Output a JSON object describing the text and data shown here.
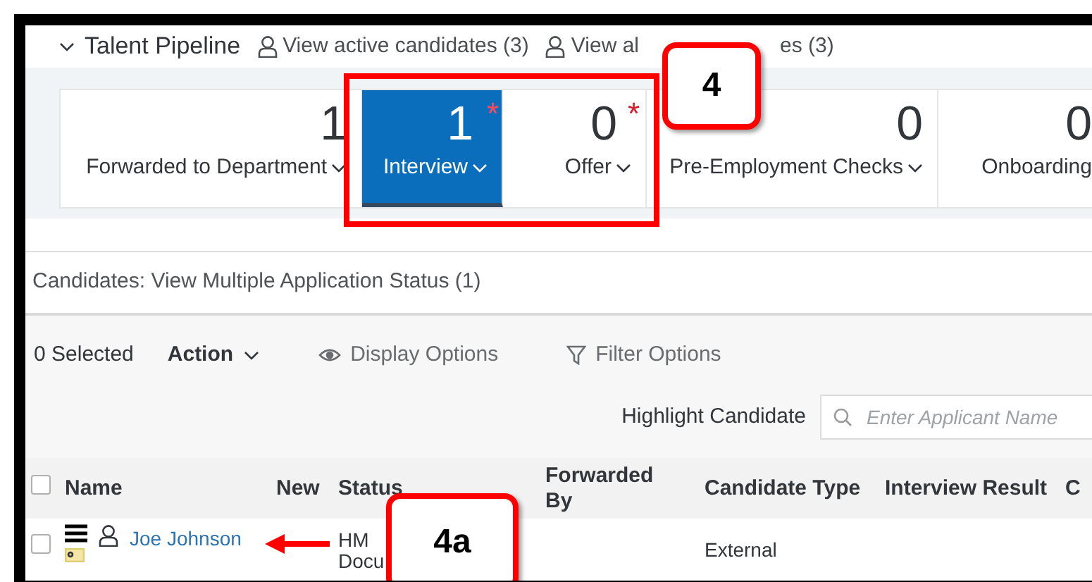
{
  "pipeline": {
    "title": "Talent Pipeline",
    "expanded": true,
    "links": [
      {
        "parts": [
          "View active candidates (3)"
        ]
      },
      {
        "parts": [
          "View al",
          "es (3)"
        ]
      }
    ]
  },
  "stages": [
    {
      "count": "1",
      "label": "Forwarded to Department",
      "selected": false
    },
    {
      "count": "1",
      "label": "Interview",
      "selected": true,
      "required_mark": "*"
    },
    {
      "count": "0",
      "label": "Offer",
      "selected": false,
      "required_mark": "*"
    },
    {
      "count": "0",
      "label": "Pre-Employment Checks",
      "selected": false
    },
    {
      "count": "0",
      "label": "Onboarding",
      "selected": false
    }
  ],
  "section_title": "Candidates: View Multiple Application Status (1)",
  "toolbar": {
    "selected_count": "0 Selected",
    "action": "Action",
    "display_options": "Display Options",
    "filter_options": "Filter Options",
    "highlight_label": "Highlight Candidate",
    "highlight_placeholder": "Enter Applicant Name"
  },
  "table": {
    "all_checked": false,
    "columns": [
      "Name",
      "New",
      "Status",
      "Forwarded By",
      "Candidate Type",
      "Interview Result",
      "C"
    ],
    "rows": [
      {
        "checked": false,
        "name": "Joe Johnson",
        "status": [
          "HM",
          "Docu"
        ],
        "candidate_type": "External"
      }
    ]
  },
  "callouts": [
    {
      "label": "4"
    },
    {
      "label": "4a"
    }
  ]
}
